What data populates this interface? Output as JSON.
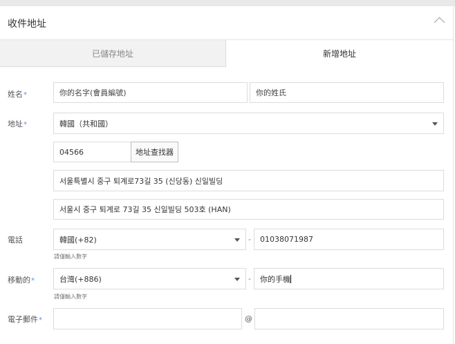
{
  "section": {
    "title": "收件地址",
    "toggle_icon": "chevron-up-icon"
  },
  "tabs": [
    {
      "label": "已儲存地址",
      "active": false
    },
    {
      "label": "新增地址",
      "active": true
    }
  ],
  "form": {
    "name": {
      "label": "姓名",
      "required_mark": "*",
      "first_name_placeholder": "你的名字(會員編號)",
      "last_name_placeholder": "你的姓氏"
    },
    "address": {
      "label": "地址",
      "required_mark": "*",
      "country_selected": "韓國（共和國）",
      "postcode_value": "04566",
      "finder_button": "地址查找器",
      "line1_value": "서울특별시 중구 퇴계로73길 35 (신당동) 신일빌딩",
      "line2_value": "서울시 중구 퇴계로 73길 35 신일빌딩 503호 (HAN)"
    },
    "phone": {
      "label": "電話",
      "country_code_selected": "韓國(+82)",
      "separator": "-",
      "number_value": "01038071987",
      "hint": "請僅輸入數字"
    },
    "mobile": {
      "label": "移動的",
      "required_mark": "*",
      "country_code_selected": "台灣(+886)",
      "separator": "-",
      "number_value": "你的手機",
      "hint": "請僅輸入數字"
    },
    "email": {
      "label": "電子郵件",
      "required_mark": "*",
      "local_value": "",
      "at_symbol": "@",
      "domain_value": ""
    }
  }
}
